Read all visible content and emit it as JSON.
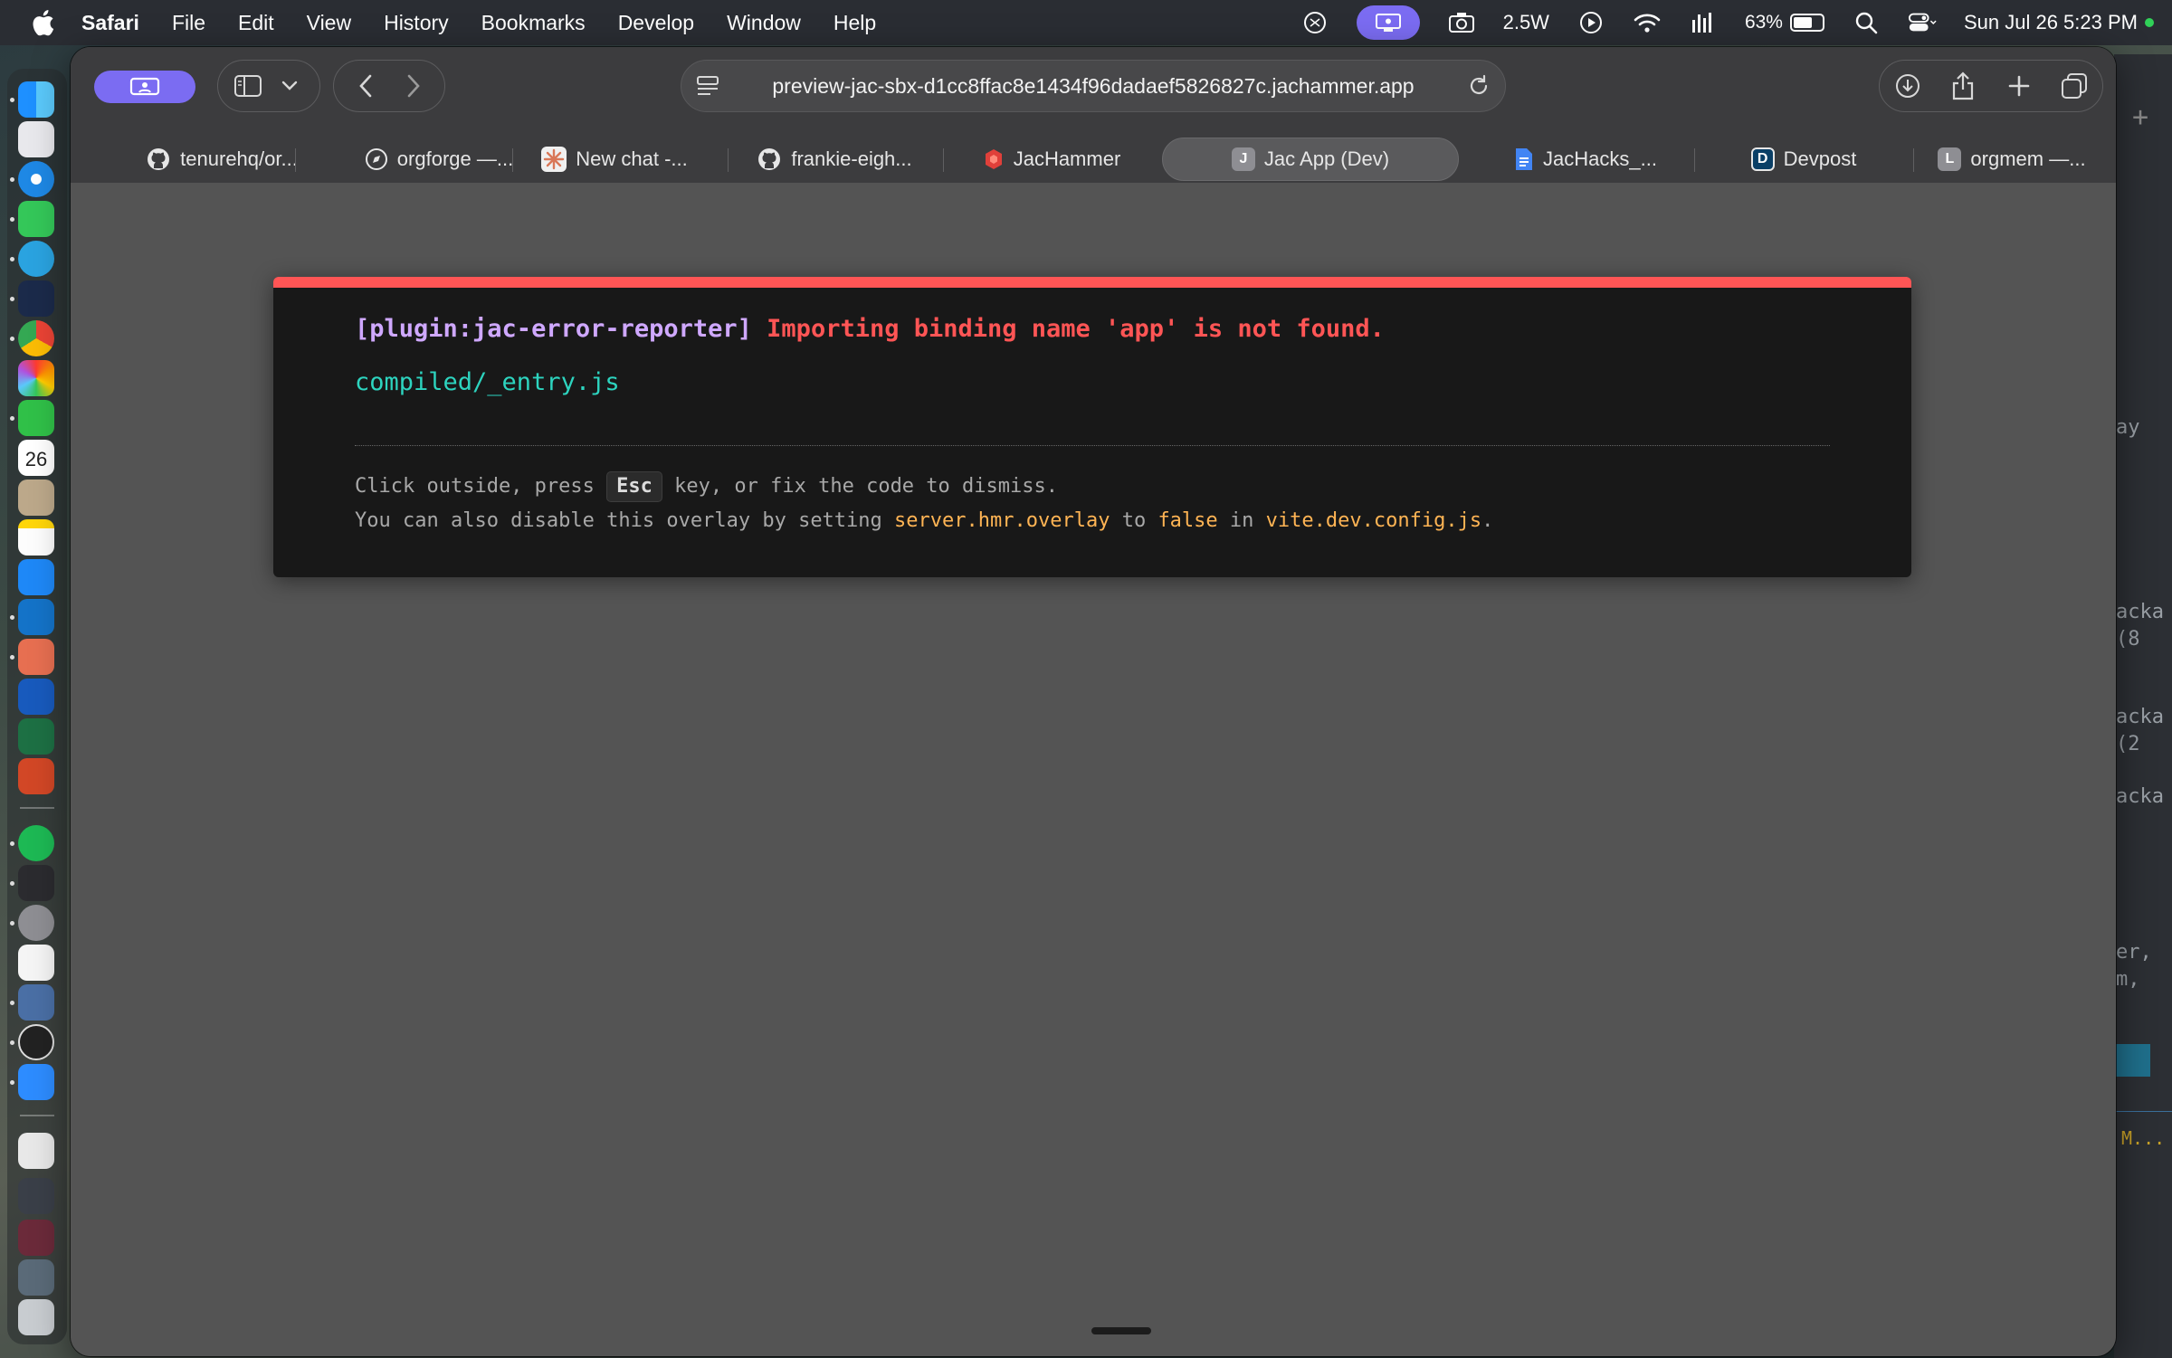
{
  "menubar": {
    "app_name": "Safari",
    "items": [
      "File",
      "Edit",
      "View",
      "History",
      "Bookmarks",
      "Develop",
      "Window",
      "Help"
    ],
    "power": "2.5W",
    "battery": "63%",
    "datetime": "Sun Jul 26  5:23 PM"
  },
  "toolbar": {
    "url": "preview-jac-sbx-d1cc8ffac8e1434f96dadaef5826827c.jachammer.app"
  },
  "tabs": [
    {
      "label": "tenurehq/or...",
      "icon": "github-icon"
    },
    {
      "label": "orgforge —...",
      "icon": "compass-icon"
    },
    {
      "label": "New chat -...",
      "icon": "claude-icon"
    },
    {
      "label": "frankie-eigh...",
      "icon": "github-icon"
    },
    {
      "label": "JacHammer",
      "icon": "jachammer-icon"
    },
    {
      "label": "Jac App (Dev)",
      "icon": "j-icon",
      "fav_letter": "J",
      "active": true
    },
    {
      "label": "JacHacks_...",
      "icon": "docs-icon"
    },
    {
      "label": "Devpost",
      "icon": "devpost-icon",
      "fav_letter": "D"
    },
    {
      "label": "orgmem —...",
      "icon": "l-icon",
      "fav_letter": "L"
    }
  ],
  "dock": {
    "calendar_day": "26"
  },
  "error_overlay": {
    "plugin": "[plugin:jac-error-reporter]",
    "message": "Importing binding name 'app' is not found.",
    "file": "compiled/_entry.js",
    "tip1_pre": "Click outside, press ",
    "tip1_key": "Esc",
    "tip1_post": " key, or fix the code to dismiss.",
    "tip2_pre": "You can also disable this overlay by setting ",
    "tip2_code1": "server.hmr.overlay",
    "tip2_mid1": " to ",
    "tip2_code2": "false",
    "tip2_mid2": " in ",
    "tip2_code3": "vite.dev.config.js",
    "tip2_end": "."
  },
  "background_window": {
    "fragments": [
      "ay",
      "acka",
      "(8",
      "acka",
      "(2",
      "acka",
      "er,",
      "m,",
      "M..."
    ]
  },
  "colors": {
    "overlay_border": "#ff5555",
    "plugin_text": "#cfa8ff",
    "file_text": "#2dd4bf",
    "code_text": "#ffb454",
    "accent": "#7b6cf2"
  }
}
